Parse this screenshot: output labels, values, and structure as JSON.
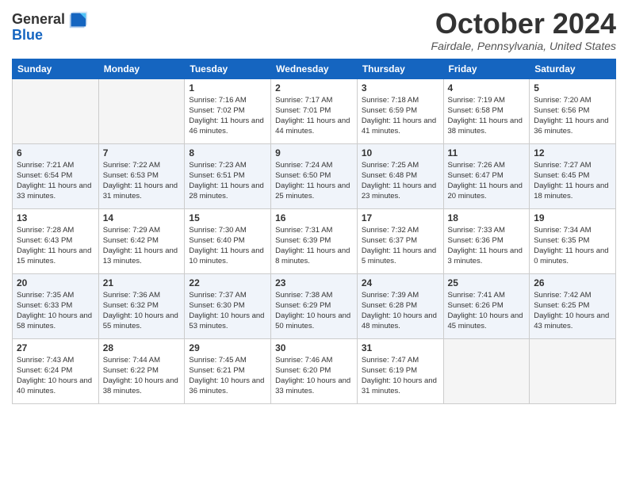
{
  "header": {
    "logo": {
      "line1": "General",
      "line2": "Blue"
    },
    "title": "October 2024",
    "location": "Fairdale, Pennsylvania, United States"
  },
  "weekdays": [
    "Sunday",
    "Monday",
    "Tuesday",
    "Wednesday",
    "Thursday",
    "Friday",
    "Saturday"
  ],
  "weeks": [
    [
      {
        "day": "",
        "sunrise": "",
        "sunset": "",
        "daylight": ""
      },
      {
        "day": "",
        "sunrise": "",
        "sunset": "",
        "daylight": ""
      },
      {
        "day": "1",
        "sunrise": "Sunrise: 7:16 AM",
        "sunset": "Sunset: 7:02 PM",
        "daylight": "Daylight: 11 hours and 46 minutes."
      },
      {
        "day": "2",
        "sunrise": "Sunrise: 7:17 AM",
        "sunset": "Sunset: 7:01 PM",
        "daylight": "Daylight: 11 hours and 44 minutes."
      },
      {
        "day": "3",
        "sunrise": "Sunrise: 7:18 AM",
        "sunset": "Sunset: 6:59 PM",
        "daylight": "Daylight: 11 hours and 41 minutes."
      },
      {
        "day": "4",
        "sunrise": "Sunrise: 7:19 AM",
        "sunset": "Sunset: 6:58 PM",
        "daylight": "Daylight: 11 hours and 38 minutes."
      },
      {
        "day": "5",
        "sunrise": "Sunrise: 7:20 AM",
        "sunset": "Sunset: 6:56 PM",
        "daylight": "Daylight: 11 hours and 36 minutes."
      }
    ],
    [
      {
        "day": "6",
        "sunrise": "Sunrise: 7:21 AM",
        "sunset": "Sunset: 6:54 PM",
        "daylight": "Daylight: 11 hours and 33 minutes."
      },
      {
        "day": "7",
        "sunrise": "Sunrise: 7:22 AM",
        "sunset": "Sunset: 6:53 PM",
        "daylight": "Daylight: 11 hours and 31 minutes."
      },
      {
        "day": "8",
        "sunrise": "Sunrise: 7:23 AM",
        "sunset": "Sunset: 6:51 PM",
        "daylight": "Daylight: 11 hours and 28 minutes."
      },
      {
        "day": "9",
        "sunrise": "Sunrise: 7:24 AM",
        "sunset": "Sunset: 6:50 PM",
        "daylight": "Daylight: 11 hours and 25 minutes."
      },
      {
        "day": "10",
        "sunrise": "Sunrise: 7:25 AM",
        "sunset": "Sunset: 6:48 PM",
        "daylight": "Daylight: 11 hours and 23 minutes."
      },
      {
        "day": "11",
        "sunrise": "Sunrise: 7:26 AM",
        "sunset": "Sunset: 6:47 PM",
        "daylight": "Daylight: 11 hours and 20 minutes."
      },
      {
        "day": "12",
        "sunrise": "Sunrise: 7:27 AM",
        "sunset": "Sunset: 6:45 PM",
        "daylight": "Daylight: 11 hours and 18 minutes."
      }
    ],
    [
      {
        "day": "13",
        "sunrise": "Sunrise: 7:28 AM",
        "sunset": "Sunset: 6:43 PM",
        "daylight": "Daylight: 11 hours and 15 minutes."
      },
      {
        "day": "14",
        "sunrise": "Sunrise: 7:29 AM",
        "sunset": "Sunset: 6:42 PM",
        "daylight": "Daylight: 11 hours and 13 minutes."
      },
      {
        "day": "15",
        "sunrise": "Sunrise: 7:30 AM",
        "sunset": "Sunset: 6:40 PM",
        "daylight": "Daylight: 11 hours and 10 minutes."
      },
      {
        "day": "16",
        "sunrise": "Sunrise: 7:31 AM",
        "sunset": "Sunset: 6:39 PM",
        "daylight": "Daylight: 11 hours and 8 minutes."
      },
      {
        "day": "17",
        "sunrise": "Sunrise: 7:32 AM",
        "sunset": "Sunset: 6:37 PM",
        "daylight": "Daylight: 11 hours and 5 minutes."
      },
      {
        "day": "18",
        "sunrise": "Sunrise: 7:33 AM",
        "sunset": "Sunset: 6:36 PM",
        "daylight": "Daylight: 11 hours and 3 minutes."
      },
      {
        "day": "19",
        "sunrise": "Sunrise: 7:34 AM",
        "sunset": "Sunset: 6:35 PM",
        "daylight": "Daylight: 11 hours and 0 minutes."
      }
    ],
    [
      {
        "day": "20",
        "sunrise": "Sunrise: 7:35 AM",
        "sunset": "Sunset: 6:33 PM",
        "daylight": "Daylight: 10 hours and 58 minutes."
      },
      {
        "day": "21",
        "sunrise": "Sunrise: 7:36 AM",
        "sunset": "Sunset: 6:32 PM",
        "daylight": "Daylight: 10 hours and 55 minutes."
      },
      {
        "day": "22",
        "sunrise": "Sunrise: 7:37 AM",
        "sunset": "Sunset: 6:30 PM",
        "daylight": "Daylight: 10 hours and 53 minutes."
      },
      {
        "day": "23",
        "sunrise": "Sunrise: 7:38 AM",
        "sunset": "Sunset: 6:29 PM",
        "daylight": "Daylight: 10 hours and 50 minutes."
      },
      {
        "day": "24",
        "sunrise": "Sunrise: 7:39 AM",
        "sunset": "Sunset: 6:28 PM",
        "daylight": "Daylight: 10 hours and 48 minutes."
      },
      {
        "day": "25",
        "sunrise": "Sunrise: 7:41 AM",
        "sunset": "Sunset: 6:26 PM",
        "daylight": "Daylight: 10 hours and 45 minutes."
      },
      {
        "day": "26",
        "sunrise": "Sunrise: 7:42 AM",
        "sunset": "Sunset: 6:25 PM",
        "daylight": "Daylight: 10 hours and 43 minutes."
      }
    ],
    [
      {
        "day": "27",
        "sunrise": "Sunrise: 7:43 AM",
        "sunset": "Sunset: 6:24 PM",
        "daylight": "Daylight: 10 hours and 40 minutes."
      },
      {
        "day": "28",
        "sunrise": "Sunrise: 7:44 AM",
        "sunset": "Sunset: 6:22 PM",
        "daylight": "Daylight: 10 hours and 38 minutes."
      },
      {
        "day": "29",
        "sunrise": "Sunrise: 7:45 AM",
        "sunset": "Sunset: 6:21 PM",
        "daylight": "Daylight: 10 hours and 36 minutes."
      },
      {
        "day": "30",
        "sunrise": "Sunrise: 7:46 AM",
        "sunset": "Sunset: 6:20 PM",
        "daylight": "Daylight: 10 hours and 33 minutes."
      },
      {
        "day": "31",
        "sunrise": "Sunrise: 7:47 AM",
        "sunset": "Sunset: 6:19 PM",
        "daylight": "Daylight: 10 hours and 31 minutes."
      },
      {
        "day": "",
        "sunrise": "",
        "sunset": "",
        "daylight": ""
      },
      {
        "day": "",
        "sunrise": "",
        "sunset": "",
        "daylight": ""
      }
    ]
  ]
}
